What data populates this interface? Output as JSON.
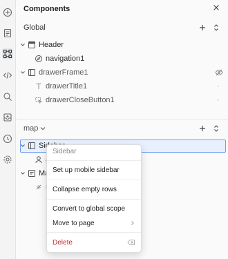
{
  "panel": {
    "title": "Components"
  },
  "global": {
    "label": "Global",
    "items": [
      {
        "label": "Header"
      },
      {
        "label": "navigation1"
      },
      {
        "label": "drawerFrame1"
      },
      {
        "label": "drawerTitle1"
      },
      {
        "label": "drawerCloseButton1"
      }
    ]
  },
  "page_section": {
    "label": "map",
    "items": [
      {
        "label": "Sidebar"
      },
      {
        "label": "a"
      },
      {
        "label": "Ma"
      },
      {
        "label": "r"
      }
    ]
  },
  "context_menu": {
    "header": "Sidebar",
    "items": [
      {
        "label": "Set up mobile sidebar"
      },
      {
        "label": "Collapse empty rows"
      },
      {
        "label": "Convert to global scope"
      },
      {
        "label": "Move to page"
      },
      {
        "label": "Delete"
      }
    ]
  },
  "colors": {
    "accent": "#6c9ef0",
    "danger": "#c62828",
    "selected_bg": "#e8f0fe"
  }
}
